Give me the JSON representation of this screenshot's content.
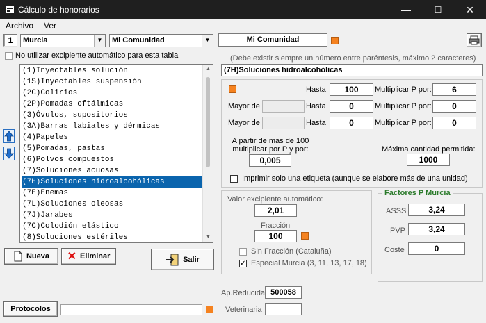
{
  "window": {
    "title": "Cálculo de honorarios",
    "min": "—",
    "max": "☐",
    "close": "✕"
  },
  "menu": {
    "items": [
      "Archivo",
      "Ver"
    ]
  },
  "toolbar": {
    "number": "1",
    "province": "Murcia",
    "community": "Mi Comunidad",
    "community_field": "Mi Comunidad"
  },
  "options": {
    "no_excipient_label": "No utilizar excipiente automático para esta tabla",
    "hint": "(Debe existir siempre un número entre paréntesis, máximo 2 caracteres)"
  },
  "list": {
    "items": [
      "(1)Inyectables solución",
      "(1S)Inyectables suspensión",
      "(2C)Colirios",
      "(2P)Pomadas oftálmicas",
      "(3)Óvulos, supositorios",
      "(3A)Barras labiales y dérmicas",
      "(4)Papeles",
      "(5)Pomadas, pastas",
      "(6)Polvos compuestos",
      "(7)Soluciones acuosas",
      "(7H)Soluciones hidroalcohólicas",
      "(7E)Enemas",
      "(7L)Soluciones oleosas",
      "(7J)Jarabes",
      "(7C)Colodión elástico",
      "(8)Soluciones estériles"
    ],
    "selected_index": 10
  },
  "detail": {
    "name": "(7H)Soluciones hidroalcohólicas",
    "row1": {
      "hasta_label": "Hasta",
      "hasta": "100",
      "mult_label": "Multiplicar P por:",
      "mult": "6"
    },
    "row2": {
      "mayor_label": "Mayor de",
      "hasta_label": "Hasta",
      "hasta": "0",
      "mult_label": "Multiplicar P por:",
      "mult": "0"
    },
    "row3": {
      "mayor_label": "Mayor de",
      "hasta_label": "Hasta",
      "hasta": "0",
      "mult_label": "Multiplicar P por:",
      "mult": "0"
    },
    "apartir_label": "A partir de mas de 100 multiplicar por P y por:",
    "apartir_value": "0,005",
    "max_label": "Máxima cantidad permitida:",
    "max_value": "1000",
    "print_label": "Imprimir solo una etiqueta (aunque se elabore más de una unidad)"
  },
  "excipient": {
    "label": "Valor excipiente automático:",
    "value": "2,01",
    "fraccion_label": "Fracción",
    "fraccion_value": "100",
    "sin_fraccion": "Sin Fracción (Cataluña)",
    "especial": "Especial Murcia (3, 11, 13, 17, 18)"
  },
  "factores": {
    "title": "Factores P Murcia",
    "asss_label": "ASSS",
    "asss": "3,24",
    "pvp_label": "PVP",
    "pvp": "3,24",
    "coste_label": "Coste",
    "coste": "0"
  },
  "bottom": {
    "ap_label": "Ap.Reducida",
    "ap_value": "500058",
    "vet_label": "Veterinaria",
    "vet_value": ""
  },
  "buttons": {
    "nueva": "Nueva",
    "eliminar": "Eliminar",
    "salir": "Salir",
    "protocolos": "Protocolos"
  },
  "colors": {
    "accent_orange": "#f5821f",
    "selection": "#0a64ad",
    "titlebar": "#1f1f1f",
    "factores_title": "#2a7a2a"
  }
}
